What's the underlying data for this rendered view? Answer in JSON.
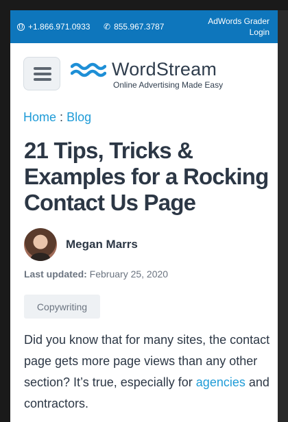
{
  "topbar": {
    "phone_1": "+1.866.971.0933",
    "phone_2": "855.967.3787",
    "grader_line_1": "AdWords Grader",
    "grader_line_2": "Login",
    "bg_color": "#0e76bc"
  },
  "header": {
    "logo_name": "WordStream",
    "logo_tagline": "Online Advertising Made Easy",
    "menu_icon": "hamburger-icon"
  },
  "breadcrumb": {
    "home": "Home",
    "separator": ":",
    "blog": "Blog"
  },
  "article": {
    "title": "21 Tips, Tricks & Examples for a Rocking Contact Us Page",
    "author": "Megan Marrs",
    "updated_label": "Last updated:",
    "updated_date": "February 25, 2020",
    "category": "Copywriting",
    "intro_before_link": "Did you know that for many sites, the contact page gets more page views than any other section? It’s true, especially for ",
    "intro_link": "agencies",
    "intro_after_link": " and contractors."
  },
  "colors": {
    "link": "#1e9bd7",
    "heading": "#2c3745"
  }
}
